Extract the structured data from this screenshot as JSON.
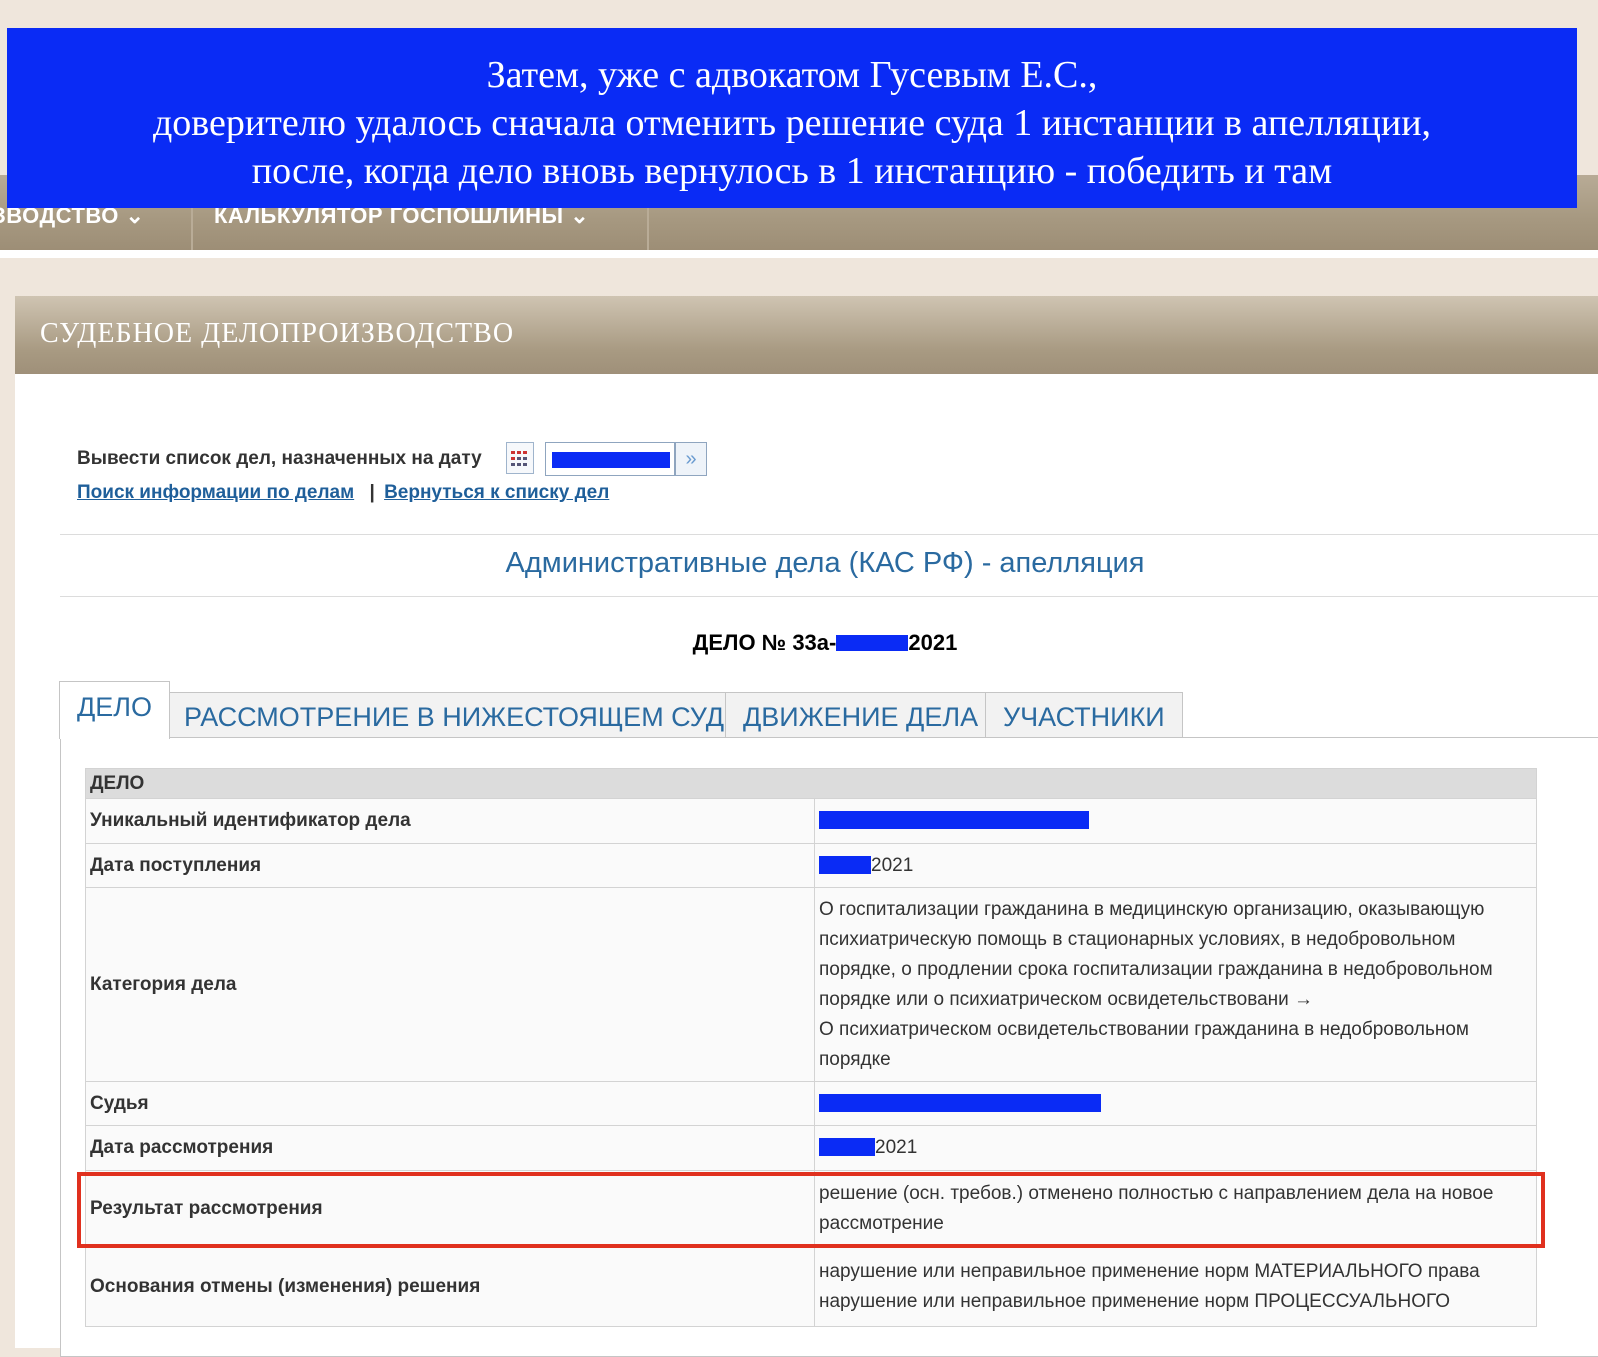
{
  "top_nav": {
    "items": [
      "ЗВОДСТВО ⌄",
      "КАЛЬКУЛЯТОР ГОСПОШЛИНЫ ⌄"
    ]
  },
  "banner": {
    "lines": [
      "Затем, уже с адвокатом Гусевым Е.С.,",
      "доверителю удалось сначала отменить решение суда 1 инстанции в апелляции,",
      "после, когда дело вновь вернулось в 1 инстанцию - победить и там"
    ]
  },
  "panel": {
    "title": "СУДЕБНОЕ ДЕЛОПРОИЗВОДСТВО"
  },
  "date_filter": {
    "label": "Вывести список дел, назначенных на дату"
  },
  "links": {
    "search": "Поиск информации по делам",
    "separator": "|",
    "back": "Вернуться к списку дел"
  },
  "section_title": "Административные дела (КАС РФ) - апелляция",
  "case": {
    "prefix": "ДЕЛО № 33а-",
    "suffix": "2021"
  },
  "tabs": [
    "ДЕЛО",
    "РАССМОТРЕНИЕ В НИЖЕСТОЯЩЕМ СУДЕ",
    "ДВИЖЕНИЕ ДЕЛА",
    "УЧАСТНИКИ"
  ],
  "table": {
    "header": "ДЕЛО",
    "rows": [
      {
        "key": "Уникальный идентификатор дела",
        "value": ""
      },
      {
        "key": "Дата поступления",
        "value": "2021"
      },
      {
        "key": "Категория дела",
        "value_lines": [
          "О госпитализации гражданина в медицинскую организацию, оказывающую",
          "психиатрическую помощь в стационарных условиях, в недобровольном",
          "порядке, о продлении срока госпитализации гражданина в недобровольном",
          "порядке или о психиатрическом освидетельствовани →",
          "О психиатрическом освидетельствовании гражданина в недобровольном",
          "порядке"
        ]
      },
      {
        "key": "Судья",
        "value": ""
      },
      {
        "key": "Дата рассмотрения",
        "value": "2021"
      },
      {
        "key": "Результат рассмотрения",
        "value_lines": [
          "решение (осн. требов.) отменено полностью с направлением дела на новое",
          "рассмотрение"
        ]
      },
      {
        "key": "Основания отмены (изменения) решения",
        "value_lines": [
          "нарушение или неправильное применение норм МАТЕРИАЛЬНОГО права",
          "нарушение или неправильное применение норм ПРОЦЕССУАЛЬНОГО"
        ]
      }
    ]
  },
  "colors": {
    "banner": "#0a2bf5",
    "redaction": "#0a2bf5",
    "highlight": "#e0301e",
    "link": "#1f5f9a",
    "heading": "#2a6aa0"
  }
}
